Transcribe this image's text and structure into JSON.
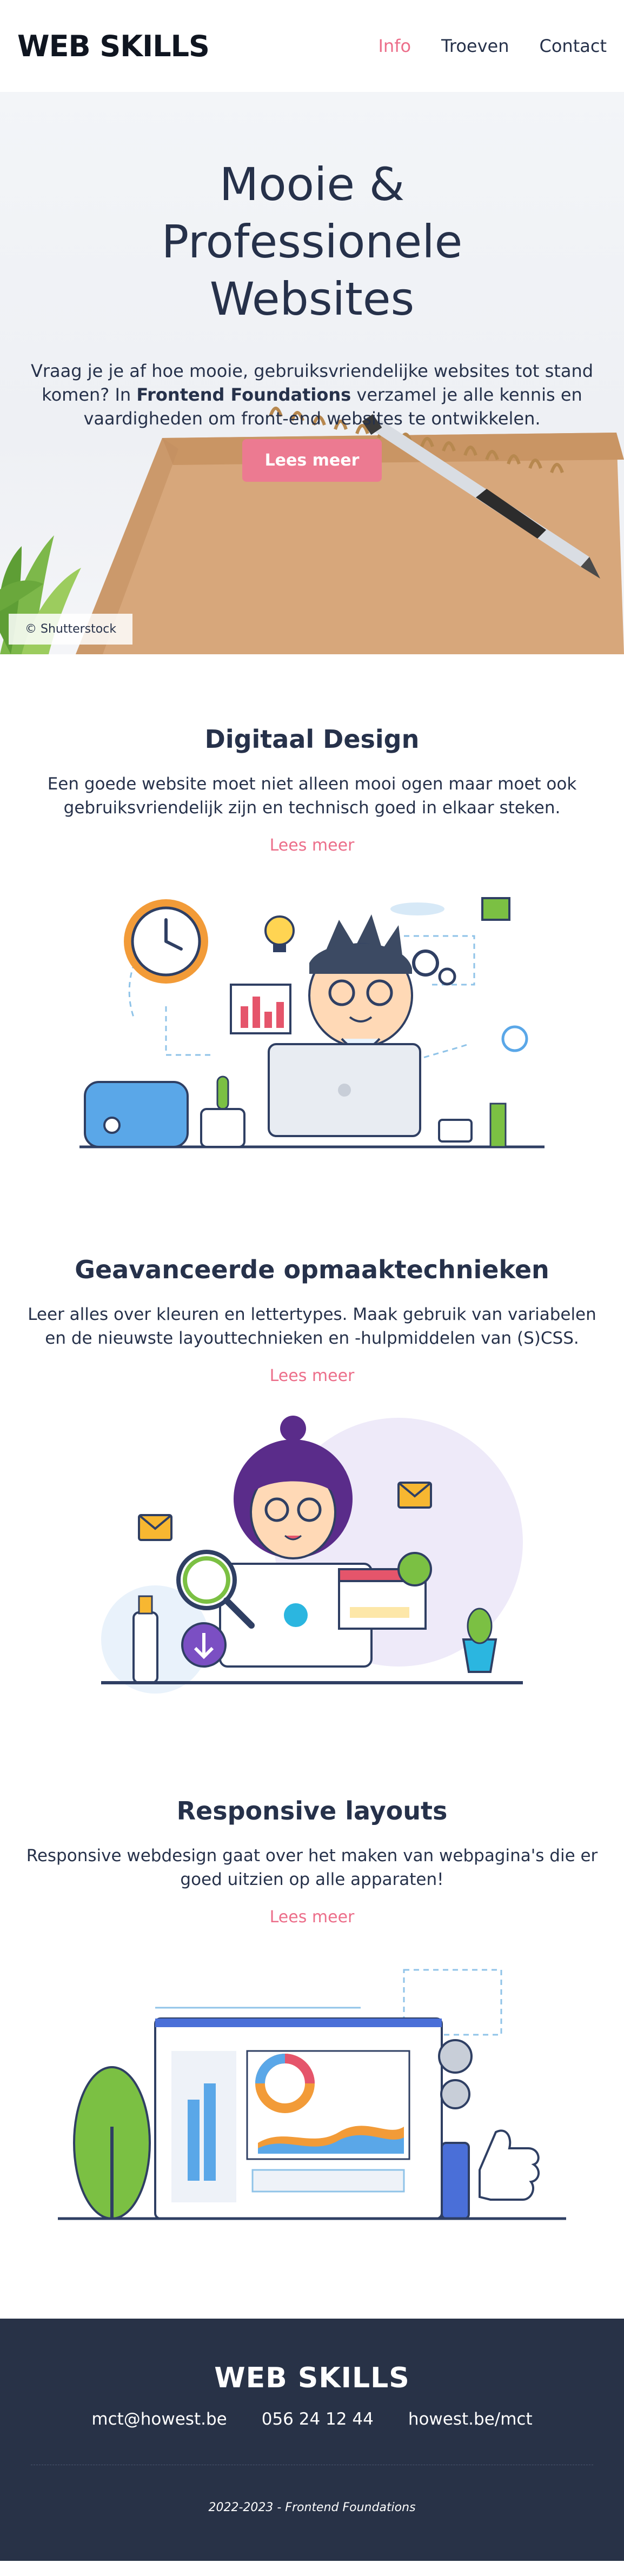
{
  "header": {
    "logo": "WEB SKILLS",
    "nav": [
      {
        "label": "Info",
        "active": true
      },
      {
        "label": "Troeven",
        "active": false
      },
      {
        "label": "Contact",
        "active": false
      }
    ]
  },
  "hero": {
    "title": "Mooie & Professionele Websites",
    "text_before": "Vraag je je af hoe mooie, gebruiksvriendelijke websites tot stand komen? In ",
    "text_bold": "Frontend Foundations",
    "text_after": " verzamel je alle kennis en vaardigheden om front-end websites te ontwikkelen.",
    "button": "Lees meer",
    "credit": "© Shutterstock"
  },
  "features": [
    {
      "title": "Digitaal Design",
      "text": "Een goede website moet niet alleen mooi ogen maar moet ook gebruiksvriendelijk zijn en technisch goed in elkaar steken.",
      "link": "Lees meer"
    },
    {
      "title": "Geavanceerde opmaaktechnieken",
      "text": "Leer alles over kleuren en lettertypes. Maak gebruik van variabelen en de nieuwste layouttechnieken en -hulpmiddelen van (S)CSS.",
      "link": "Lees meer"
    },
    {
      "title": "Responsive layouts",
      "text": "Responsive webdesign gaat over het maken van webpagina's die er goed uitzien op alle apparaten!",
      "link": "Lees meer"
    }
  ],
  "footer": {
    "logo": "WEB SKILLS",
    "email": "mct@howest.be",
    "phone": "056 24 12 44",
    "site": "howest.be/mct",
    "copyright": "2022-2023 - Frontend Foundations"
  },
  "colors": {
    "accent": "#ec6e8a",
    "text": "#26314a",
    "footer_bg": "#283247"
  }
}
